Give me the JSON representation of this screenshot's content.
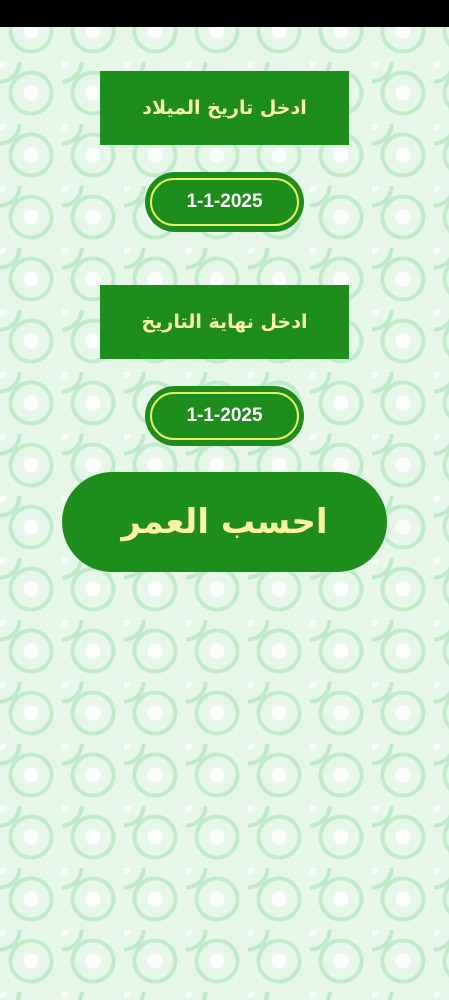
{
  "birth_date": {
    "label": "ادخل تاريخ الميلاد",
    "value": "1-1-2025"
  },
  "end_date": {
    "label": "ادخل نهاية التاريخ",
    "value": "1-1-2025"
  },
  "calculate_button": {
    "label": "احسب العمر"
  },
  "colors": {
    "primary_green": "#1d8e1b",
    "label_text": "#fff4a8",
    "date_text": "#ffffff",
    "date_border": "#e6f06a",
    "background": "#d9f3df",
    "status_bar": "#000000"
  }
}
